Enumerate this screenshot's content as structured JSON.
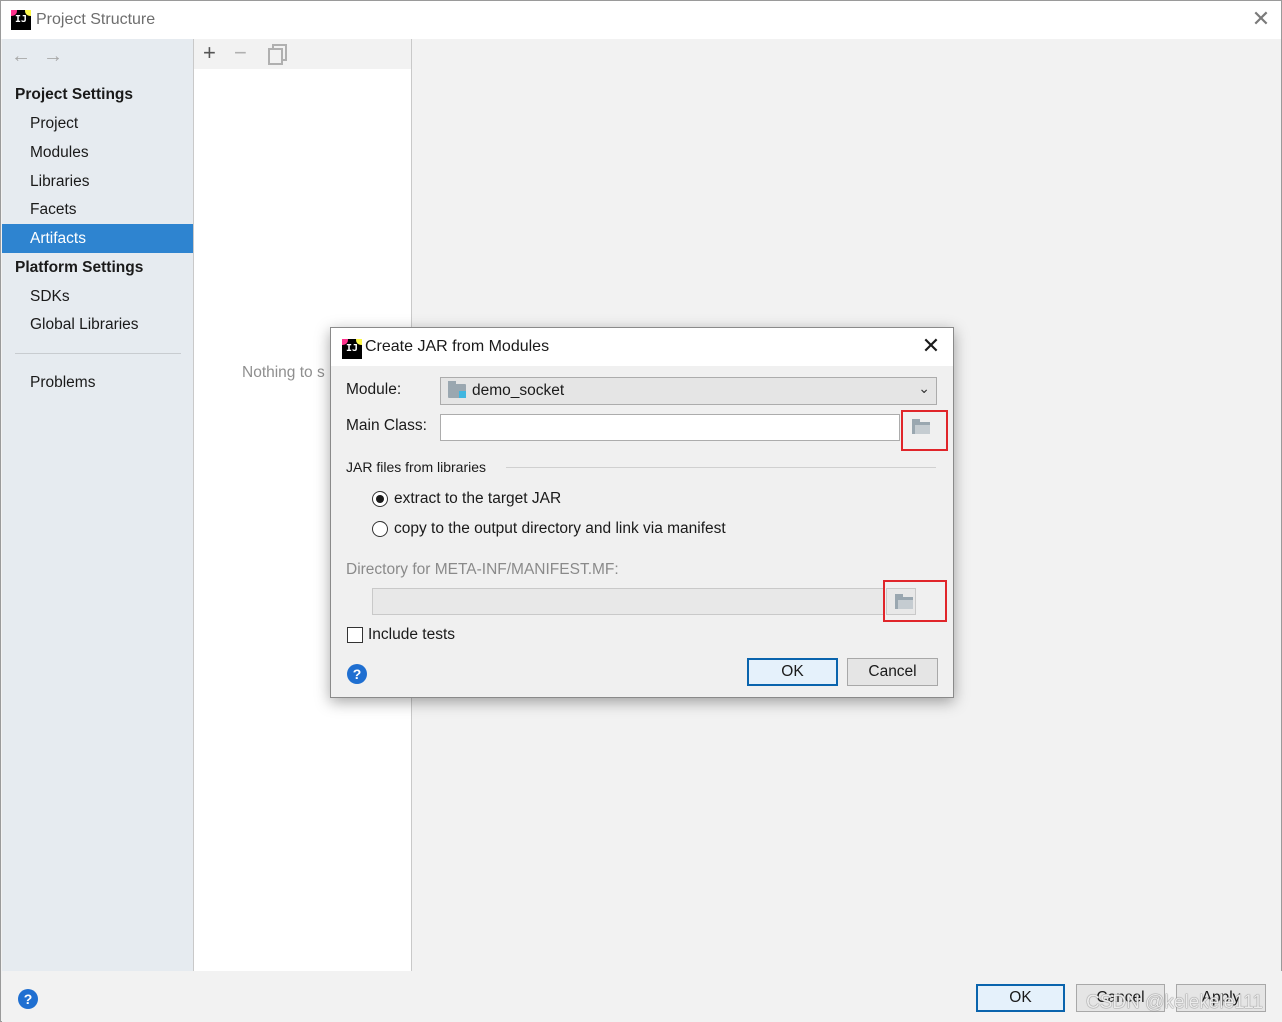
{
  "window": {
    "title": "Project Structure",
    "close_glyph": "✕",
    "icon_text": "IJ"
  },
  "nav": {
    "back_glyph": "←",
    "forward_glyph": "→"
  },
  "sidebar": {
    "project_settings_header": "Project Settings",
    "project_items": [
      {
        "label": "Project"
      },
      {
        "label": "Modules"
      },
      {
        "label": "Libraries"
      },
      {
        "label": "Facets"
      },
      {
        "label": "Artifacts",
        "selected": true
      }
    ],
    "platform_settings_header": "Platform Settings",
    "platform_items": [
      {
        "label": "SDKs"
      },
      {
        "label": "Global Libraries"
      }
    ],
    "problems_label": "Problems"
  },
  "artifacts_panel": {
    "add_glyph": "+",
    "remove_glyph": "−",
    "empty_text": "Nothing to s"
  },
  "footer": {
    "help_glyph": "?",
    "ok_label": "OK",
    "cancel_label": "Cancel",
    "apply_label": "Apply",
    "watermark": "CSDN @kelekele111"
  },
  "dialog": {
    "title": "Create JAR from Modules",
    "close_glyph": "✕",
    "module_label": "Module:",
    "module_value": "demo_socket",
    "module_chevron": "⌄",
    "main_class_label": "Main Class:",
    "main_class_value": "",
    "jar_group_label": "JAR files from libraries",
    "radio_extract_label": "extract to the target JAR",
    "radio_copy_label": "copy to the output directory and link via manifest",
    "selected_option": "extract to the target JAR",
    "directory_label": "Directory for META-INF/MANIFEST.MF:",
    "directory_value": "",
    "include_tests_label": "Include tests",
    "include_tests_checked": false,
    "help_glyph": "?",
    "ok_label": "OK",
    "cancel_label": "Cancel"
  },
  "colors": {
    "selection": "#2e84d0",
    "highlight_box": "#e0252a",
    "help_icon": "#1f6fd1",
    "primary_border": "#0a64ad"
  },
  "icons": [
    "app-icon",
    "back-arrow-icon",
    "forward-arrow-icon",
    "add-icon",
    "remove-icon",
    "copy-icon",
    "folder-icon",
    "help-icon",
    "close-icon",
    "chevron-down-icon"
  ]
}
